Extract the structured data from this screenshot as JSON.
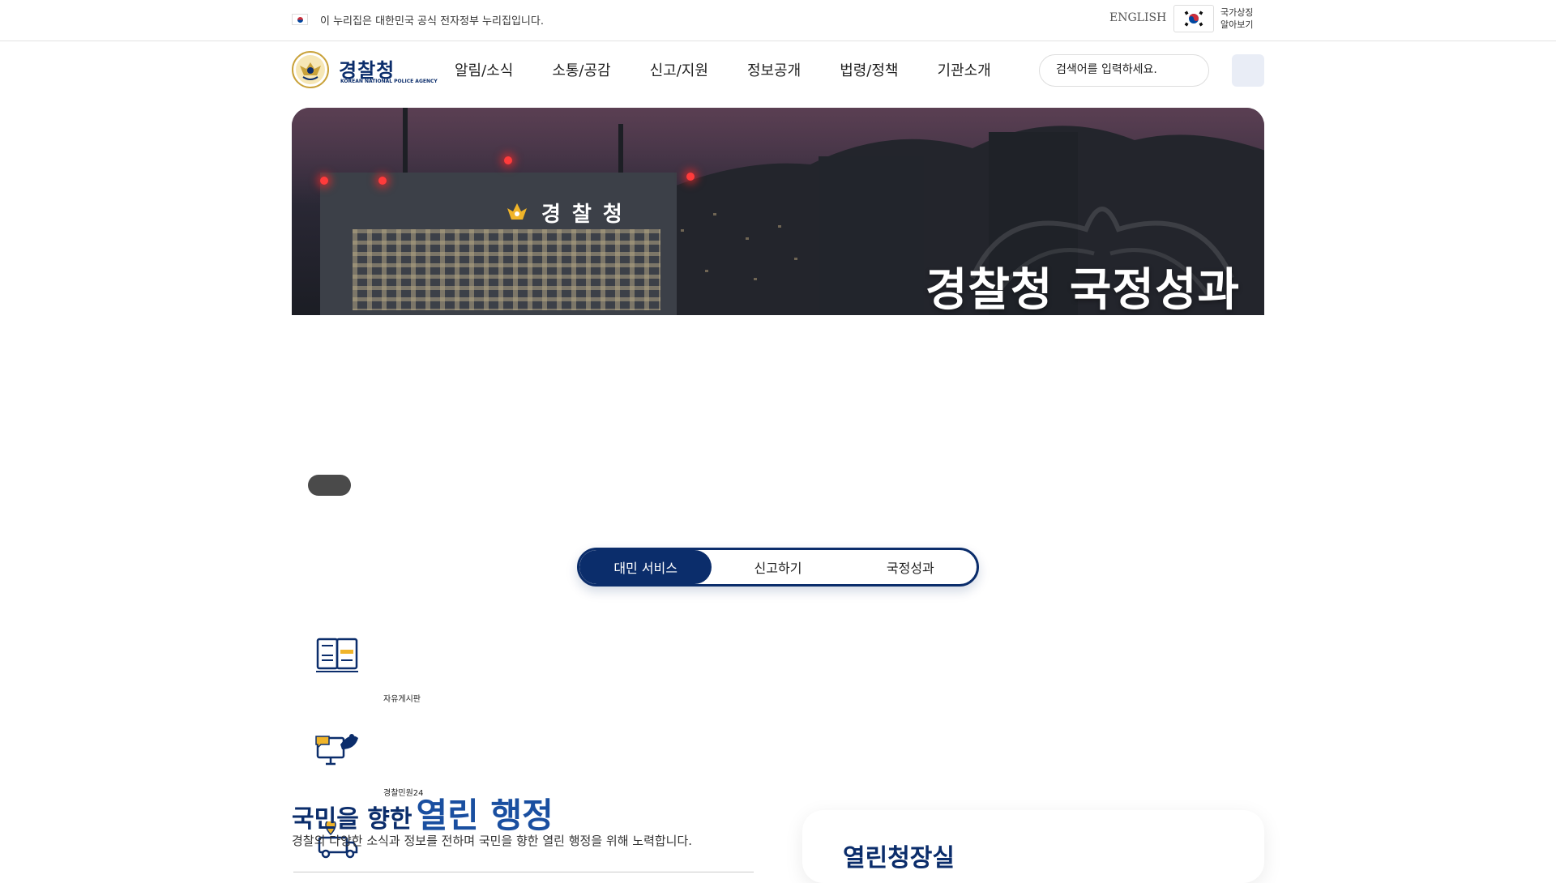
{
  "topbar": {
    "gov_notice": "이 누리집은 대한민국 공식 전자정부 누리집입니다.",
    "english_label": "ENGLISH",
    "symbol_label_1": "국가상징",
    "symbol_label_2": "알아보기"
  },
  "header": {
    "logo_ko": "경찰청",
    "logo_en": "KOREAN NATIONAL POLICE AGENCY",
    "nav": [
      "알림/소식",
      "소통/공감",
      "신고/지원",
      "정보공개",
      "법령/정책",
      "기관소개"
    ],
    "search_placeholder": "검색어를 입력하세요."
  },
  "hero": {
    "sign_text": "경찰청",
    "title": "경찰청 국정성과"
  },
  "tabs": [
    "대민 서비스",
    "신고하기",
    "국정성과"
  ],
  "services": [
    {
      "label": "자유게시판",
      "icon": "board-icon"
    },
    {
      "label": "경찰민원24",
      "icon": "civil-complaint-icon"
    },
    {
      "label": "",
      "icon": "delivery-truck-icon"
    }
  ],
  "section": {
    "title_small": "국민을 향한",
    "title_big": "열린 행정",
    "description": "경찰의 다양한 소식과 정보를 전하며 국민을 향한 열린 행정을 위해 노력합니다."
  },
  "card": {
    "title": "열린청장실"
  },
  "colors": {
    "brand_navy": "#0b2d6b",
    "brand_blue": "#1a4fa0",
    "accent_yellow": "#f0b429"
  }
}
